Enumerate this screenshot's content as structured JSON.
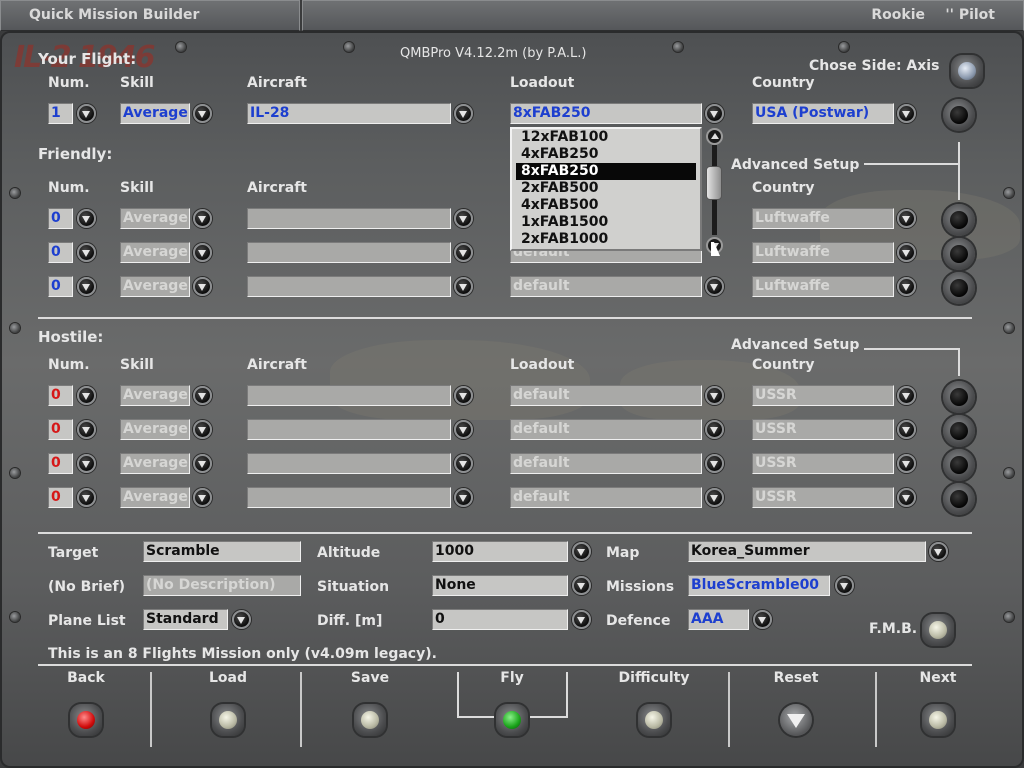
{
  "titlebar": {
    "left": "Quick Mission Builder",
    "rank": "Rookie",
    "pilot": "'' Pilot"
  },
  "version": "QMBPro V4.12.2m (by P.A.L.)",
  "logo": "IL-2 1946",
  "your_flight": {
    "title": "Your Flight:",
    "headers": {
      "num": "Num.",
      "skill": "Skill",
      "aircraft": "Aircraft",
      "loadout": "Loadout",
      "country": "Country"
    },
    "chose_side": "Chose Side: Axis",
    "row": {
      "num": "1",
      "skill": "Average",
      "aircraft": "IL-28",
      "loadout": "8xFAB250",
      "country": "USA (Postwar)"
    }
  },
  "loadout_dropdown": {
    "options": [
      "12xFAB100",
      "4xFAB250",
      "8xFAB250",
      "2xFAB500",
      "4xFAB500",
      "1xFAB1500",
      "2xFAB1000"
    ],
    "selected_index": 2
  },
  "friendly": {
    "title": "Friendly:",
    "advanced_setup": "Advanced Setup",
    "headers": {
      "num": "Num.",
      "skill": "Skill",
      "aircraft": "Aircraft",
      "country": "Country"
    },
    "rows": [
      {
        "num": "0",
        "skill": "Average",
        "aircraft": "",
        "loadout": "",
        "country": "Luftwaffe"
      },
      {
        "num": "0",
        "skill": "Average",
        "aircraft": "",
        "loadout": "default",
        "country": "Luftwaffe"
      },
      {
        "num": "0",
        "skill": "Average",
        "aircraft": "",
        "loadout": "default",
        "country": "Luftwaffe"
      }
    ]
  },
  "hostile": {
    "title": "Hostile:",
    "advanced_setup": "Advanced Setup",
    "headers": {
      "num": "Num.",
      "skill": "Skill",
      "aircraft": "Aircraft",
      "loadout": "Loadout",
      "country": "Country"
    },
    "rows": [
      {
        "num": "0",
        "skill": "Average",
        "aircraft": "",
        "loadout": "default",
        "country": "USSR"
      },
      {
        "num": "0",
        "skill": "Average",
        "aircraft": "",
        "loadout": "default",
        "country": "USSR"
      },
      {
        "num": "0",
        "skill": "Average",
        "aircraft": "",
        "loadout": "default",
        "country": "USSR"
      },
      {
        "num": "0",
        "skill": "Average",
        "aircraft": "",
        "loadout": "default",
        "country": "USSR"
      }
    ]
  },
  "settings": {
    "target_label": "Target",
    "target": "Scramble",
    "altitude_label": "Altitude",
    "altitude": "1000",
    "map_label": "Map",
    "map": "Korea_Summer",
    "brief_label": "(No Brief)",
    "brief": "(No Description)",
    "situation_label": "Situation",
    "situation": "None",
    "missions_label": "Missions",
    "missions": "BlueScramble00",
    "planelist_label": "Plane List",
    "planelist": "Standard",
    "diff_label": "Diff. [m]",
    "diff": "0",
    "defence_label": "Defence",
    "defence": "AAA",
    "fmb": "F.M.B."
  },
  "status_message": "This is an 8 Flights Mission only (v4.09m legacy).",
  "buttons": {
    "back": "Back",
    "load": "Load",
    "save": "Save",
    "fly": "Fly",
    "difficulty": "Difficulty",
    "reset": "Reset",
    "next": "Next"
  }
}
